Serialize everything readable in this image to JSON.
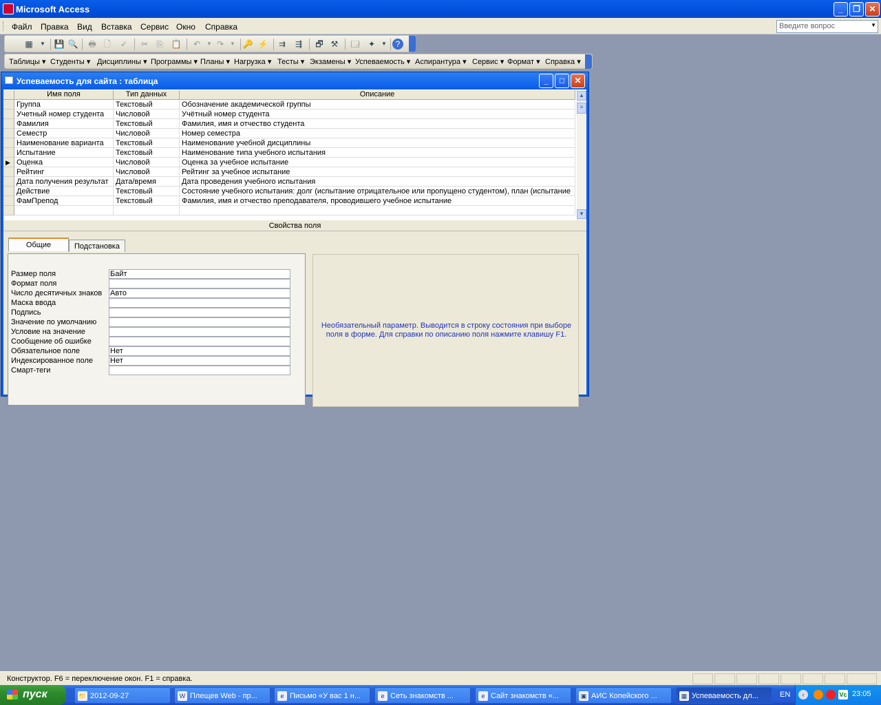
{
  "app": {
    "title": "Microsoft Access"
  },
  "menubar": {
    "items": [
      "Файл",
      "Правка",
      "Вид",
      "Вставка",
      "Сервис",
      "Окно",
      "Справка"
    ],
    "ask_placeholder": "Введите вопрос"
  },
  "toolbar2": {
    "items": [
      "Таблицы",
      "Студенты",
      "Дисциплины",
      "Программы",
      "Планы",
      "Нагрузка",
      "Тесты",
      "Экзамены",
      "Успеваемость",
      "Аспирантура",
      "Сервис",
      "Формат",
      "Справка"
    ]
  },
  "table_window": {
    "title": "Успеваемость для сайта : таблица",
    "columns": [
      "Имя поля",
      "Тип данных",
      "Описание"
    ],
    "rows": [
      {
        "name": "Группа",
        "type": "Текстовый",
        "desc": "Обозначение академической группы"
      },
      {
        "name": "Учетный номер студента",
        "type": "Числовой",
        "desc": "Учётный номер студента"
      },
      {
        "name": "Фамилия",
        "type": "Текстовый",
        "desc": "Фамилия, имя и отчество студента"
      },
      {
        "name": "Семестр",
        "type": "Числовой",
        "desc": "Номер семестра"
      },
      {
        "name": "Наименование варианта",
        "type": "Текстовый",
        "desc": "Наименование учебной дисциплины"
      },
      {
        "name": "Испытание",
        "type": "Текстовый",
        "desc": "Наименование типа учебного испытания"
      },
      {
        "name": "Оценка",
        "type": "Числовой",
        "desc": "Оценка за учебное испытание"
      },
      {
        "name": "Рейтинг",
        "type": "Числовой",
        "desc": "Рейтинг за учебное испытание"
      },
      {
        "name": "Дата получения результат",
        "type": "Дата/время",
        "desc": "Дата проведения учебного испытания"
      },
      {
        "name": "Действие",
        "type": "Текстовый",
        "desc": "Состояние учебного испытания: долг (испытание отрицательное или пропущено студентом), план (испытание"
      },
      {
        "name": "ФамПрепод",
        "type": "Текстовый",
        "desc": "Фамилия, имя и отчество преподавателя, проводившего учебное испытание"
      }
    ],
    "field_props_label": "Свойства поля",
    "tabs": [
      "Общие",
      "Подстановка"
    ],
    "properties": [
      {
        "label": "Размер поля",
        "value": "Байт"
      },
      {
        "label": "Формат поля",
        "value": ""
      },
      {
        "label": "Число десятичных знаков",
        "value": "Авто"
      },
      {
        "label": "Маска ввода",
        "value": ""
      },
      {
        "label": "Подпись",
        "value": ""
      },
      {
        "label": "Значение по умолчанию",
        "value": ""
      },
      {
        "label": "Условие на значение",
        "value": ""
      },
      {
        "label": "Сообщение об ошибке",
        "value": ""
      },
      {
        "label": "Обязательное поле",
        "value": "Нет"
      },
      {
        "label": "Индексированное поле",
        "value": "Нет"
      },
      {
        "label": "Смарт-теги",
        "value": ""
      }
    ],
    "help_line1": "Необязательный параметр.  Выводится в строку состояния при выборе",
    "help_line2": "поля в форме.  Для справки по описанию поля нажмите клавишу F1."
  },
  "status": {
    "text": "Конструктор.  F6 = переключение окон.  F1 = справка."
  },
  "taskbar": {
    "start_label": "пуск",
    "tasks": [
      "2012-09-27",
      "Плещев Web - пр...",
      "Письмо «У вас 1 н...",
      "Сеть знакомств ...",
      "Сайт знакомств «...",
      "АИС Копейского ...",
      "Успеваемость дл..."
    ],
    "lang": "EN",
    "clock": "23:05"
  }
}
